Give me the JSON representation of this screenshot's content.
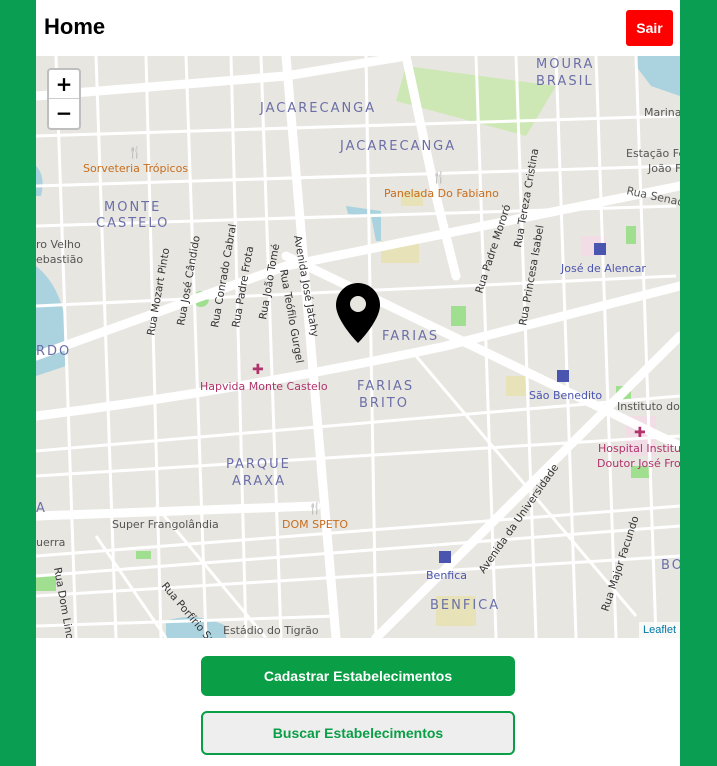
{
  "header": {
    "title": "Home",
    "logout_label": "Sair"
  },
  "map": {
    "zoom_in_label": "+",
    "zoom_out_label": "−",
    "attribution": "Leaflet",
    "labels": {
      "moura_brasil": "MOURA\nBRASIL",
      "jacarecanga_1": "JACARECANGA",
      "jacarecanga_2": "JACARECANGA",
      "monte_castelo": "MONTE\nCASTELO",
      "farias_brito": "FARIAS\nBRITO",
      "parque_araxa": "PARQUE\nARAXA",
      "benfica_district": "BENFICA",
      "marina": "Marina",
      "estacao": "Estação Fe\nJoão Fe",
      "rua_senador": "Rua Senado",
      "sorveteria": "Sorveteria Trópicos",
      "panelada": "Panelada Do Fabiano",
      "jose_alencar": "José de Alencar",
      "sao_benedito": "São Benedito",
      "instituto": "Instituto do C",
      "hospital": "Hospital Institut\nDoutor José Frot",
      "hapvida": "Hapvida Monte Castelo",
      "super_frangolandia": "Super Frangolândia",
      "dom_speto": "DOM SPETO",
      "benfica_station": "Benfica",
      "estadio": "Estádio do Tigrão",
      "velho": "ro Velho\nebastião",
      "rdo": "RDO",
      "uerra": "uerra",
      "bo": "BO",
      "a_letter": "A",
      "rua_mozart_pinto": "Rua Mozart Pinto",
      "rua_jose_candido": "Rua José Cândido",
      "rua_conrado_cabral": "Rua Conrado Cabral",
      "rua_padre_frota": "Rua Padre Frota",
      "rua_joao_tome": "Rua João Tomé",
      "rua_teofilo_gurgel": "Rua Teófilo Gurgel",
      "avenida_jose_jatahy": "Avenida José Jatahy",
      "rua_padre_mororo": "Rua Padre Mororó",
      "rua_tereza_cristina": "Rua Tereza Cristina",
      "rua_princesa_isabel": "Rua Princesa Isabel",
      "avenida_universidade": "Avenida da Universidade",
      "rua_major_facundo": "Rua Major Facundo",
      "rua_porfirio": "Rua Porfírio Sa",
      "rua_dom_lino": "Rua Dom Lino"
    },
    "colors": {
      "water": "#aad3df",
      "park": "#9fdf8f",
      "road": "#ffffff",
      "base": "#e8e6e1",
      "district_label": "#6b6fa8",
      "poi_orange": "#c76e1e",
      "transit_label": "#4a55b0",
      "hospital_label": "#b0336c"
    }
  },
  "actions": {
    "register_label": "Cadastrar Estabelecimentos",
    "search_label": "Buscar Estabelecimentos"
  }
}
